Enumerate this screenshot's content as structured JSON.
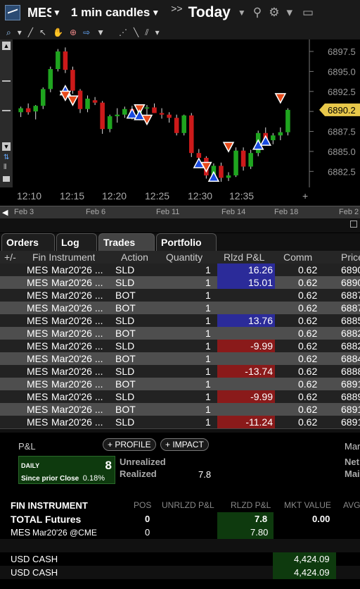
{
  "topbar": {
    "symbol": "MES",
    "interval": "1 min candles",
    "range": "Today"
  },
  "chart_data": {
    "type": "candlestick",
    "x_ticks": [
      "12:10",
      "12:15",
      "12:20",
      "12:25",
      "12:30",
      "12:35"
    ],
    "y_ticks": [
      "6897.5",
      "6895.0",
      "6892.5",
      "6890.0",
      "6887.5",
      "6885.0",
      "6882.5"
    ],
    "y_range": [
      6880.5,
      6899.0
    ],
    "current_price": "6890.2",
    "candles": [
      {
        "o": 6889.9,
        "h": 6890.6,
        "l": 6889.3,
        "c": 6890.4
      },
      {
        "o": 6890.4,
        "h": 6891.0,
        "l": 6889.6,
        "c": 6889.9
      },
      {
        "o": 6890.0,
        "h": 6890.8,
        "l": 6889.0,
        "c": 6890.7
      },
      {
        "o": 6890.7,
        "h": 6893.0,
        "l": 6890.3,
        "c": 6892.8
      },
      {
        "o": 6892.8,
        "h": 6895.6,
        "l": 6892.4,
        "c": 6895.3
      },
      {
        "o": 6895.3,
        "h": 6897.8,
        "l": 6895.0,
        "c": 6897.5
      },
      {
        "o": 6897.5,
        "h": 6898.0,
        "l": 6894.8,
        "c": 6895.2
      },
      {
        "o": 6895.2,
        "h": 6895.6,
        "l": 6892.2,
        "c": 6892.6
      },
      {
        "o": 6892.6,
        "h": 6892.8,
        "l": 6889.8,
        "c": 6890.3
      },
      {
        "o": 6890.3,
        "h": 6892.0,
        "l": 6889.9,
        "c": 6891.6
      },
      {
        "o": 6891.4,
        "h": 6891.8,
        "l": 6890.8,
        "c": 6891.1
      },
      {
        "o": 6891.1,
        "h": 6891.3,
        "l": 6887.2,
        "c": 6887.8
      },
      {
        "o": 6887.8,
        "h": 6889.6,
        "l": 6887.4,
        "c": 6889.4
      },
      {
        "o": 6889.4,
        "h": 6890.4,
        "l": 6888.6,
        "c": 6889.6
      },
      {
        "o": 6889.6,
        "h": 6890.6,
        "l": 6889.2,
        "c": 6890.3
      },
      {
        "o": 6890.3,
        "h": 6890.7,
        "l": 6889.0,
        "c": 6889.3
      },
      {
        "o": 6889.3,
        "h": 6890.5,
        "l": 6888.9,
        "c": 6890.4
      },
      {
        "o": 6890.4,
        "h": 6890.8,
        "l": 6889.6,
        "c": 6890.5
      },
      {
        "o": 6890.5,
        "h": 6891.0,
        "l": 6889.8,
        "c": 6889.8
      },
      {
        "o": 6889.8,
        "h": 6890.4,
        "l": 6889.1,
        "c": 6889.6
      },
      {
        "o": 6889.6,
        "h": 6889.9,
        "l": 6888.6,
        "c": 6889.2
      },
      {
        "o": 6889.2,
        "h": 6889.6,
        "l": 6887.0,
        "c": 6887.3
      },
      {
        "o": 6887.3,
        "h": 6889.6,
        "l": 6887.0,
        "c": 6889.5
      },
      {
        "o": 6889.5,
        "h": 6889.8,
        "l": 6884.3,
        "c": 6884.8
      },
      {
        "o": 6884.8,
        "h": 6885.3,
        "l": 6884.0,
        "c": 6884.2
      },
      {
        "o": 6884.2,
        "h": 6884.4,
        "l": 6881.6,
        "c": 6882.0
      },
      {
        "o": 6882.0,
        "h": 6883.5,
        "l": 6881.5,
        "c": 6883.2
      },
      {
        "o": 6883.2,
        "h": 6883.6,
        "l": 6881.2,
        "c": 6881.7
      },
      {
        "o": 6881.7,
        "h": 6882.4,
        "l": 6881.3,
        "c": 6882.0
      },
      {
        "o": 6882.0,
        "h": 6885.5,
        "l": 6881.8,
        "c": 6885.1
      },
      {
        "o": 6885.1,
        "h": 6885.5,
        "l": 6882.6,
        "c": 6883.1
      },
      {
        "o": 6883.1,
        "h": 6885.2,
        "l": 6882.8,
        "c": 6884.8
      },
      {
        "o": 6884.8,
        "h": 6887.6,
        "l": 6884.4,
        "c": 6887.3
      },
      {
        "o": 6887.3,
        "h": 6888.0,
        "l": 6885.9,
        "c": 6886.4
      },
      {
        "o": 6886.4,
        "h": 6887.3,
        "l": 6885.9,
        "c": 6887.0
      },
      {
        "o": 6887.0,
        "h": 6888.0,
        "l": 6886.4,
        "c": 6887.4
      },
      {
        "o": 6887.4,
        "h": 6890.4,
        "l": 6887.0,
        "c": 6890.2
      }
    ],
    "trade_markers": [
      {
        "i": 6,
        "side": "BOT",
        "price": 6892.6
      },
      {
        "i": 6,
        "side": "SLD",
        "price": 6892.0
      },
      {
        "i": 7,
        "side": "SLD",
        "price": 6891.4
      },
      {
        "i": 15,
        "side": "BOT",
        "price": 6889.7
      },
      {
        "i": 16,
        "side": "SLD",
        "price": 6890.3
      },
      {
        "i": 16,
        "side": "BOT",
        "price": 6889.5
      },
      {
        "i": 17,
        "side": "SLD",
        "price": 6889.0
      },
      {
        "i": 24,
        "side": "BOT",
        "price": 6883.5
      },
      {
        "i": 25,
        "side": "SLD",
        "price": 6883.1
      },
      {
        "i": 26,
        "side": "BOT",
        "price": 6881.8
      },
      {
        "i": 28,
        "side": "SLD",
        "price": 6885.6
      },
      {
        "i": 32,
        "side": "BOT",
        "price": 6885.8
      },
      {
        "i": 33,
        "side": "BOT",
        "price": 6886.3
      },
      {
        "i": 35,
        "side": "SLD",
        "price": 6891.7
      }
    ]
  },
  "navigator": {
    "dates": [
      "Feb 3",
      "Feb 6",
      "Feb 11",
      "Feb 14",
      "Feb 18",
      "Feb 2"
    ]
  },
  "tabs": [
    "Orders",
    "Log",
    "Trades",
    "Portfolio"
  ],
  "trades": {
    "columns": [
      "+/-",
      "Fin Instrument",
      "Action",
      "Quantity",
      "Rlzd P&L",
      "Comm",
      "Price"
    ],
    "rows": [
      {
        "sym": "MES",
        "exp": "Mar20'26 ...",
        "action": "SLD",
        "qty": "1",
        "pnl": "16.26",
        "pnl_sign": "pos",
        "comm": "0.62",
        "price": "6890"
      },
      {
        "sym": "MES",
        "exp": "Mar20'26 ...",
        "action": "SLD",
        "qty": "1",
        "pnl": "15.01",
        "pnl_sign": "pos",
        "comm": "0.62",
        "price": "6890"
      },
      {
        "sym": "MES",
        "exp": "Mar20'26 ...",
        "action": "BOT",
        "qty": "1",
        "pnl": "",
        "pnl_sign": "",
        "comm": "0.62",
        "price": "6887"
      },
      {
        "sym": "MES",
        "exp": "Mar20'26 ...",
        "action": "BOT",
        "qty": "1",
        "pnl": "",
        "pnl_sign": "",
        "comm": "0.62",
        "price": "6887"
      },
      {
        "sym": "MES",
        "exp": "Mar20'26 ...",
        "action": "SLD",
        "qty": "1",
        "pnl": "13.76",
        "pnl_sign": "pos",
        "comm": "0.62",
        "price": "6885"
      },
      {
        "sym": "MES",
        "exp": "Mar20'26 ...",
        "action": "BOT",
        "qty": "1",
        "pnl": "",
        "pnl_sign": "",
        "comm": "0.62",
        "price": "6882"
      },
      {
        "sym": "MES",
        "exp": "Mar20'26 ...",
        "action": "SLD",
        "qty": "1",
        "pnl": "-9.99",
        "pnl_sign": "neg",
        "comm": "0.62",
        "price": "6882"
      },
      {
        "sym": "MES",
        "exp": "Mar20'26 ...",
        "action": "BOT",
        "qty": "1",
        "pnl": "",
        "pnl_sign": "",
        "comm": "0.62",
        "price": "6884"
      },
      {
        "sym": "MES",
        "exp": "Mar20'26 ...",
        "action": "SLD",
        "qty": "1",
        "pnl": "-13.74",
        "pnl_sign": "neg",
        "comm": "0.62",
        "price": "6888"
      },
      {
        "sym": "MES",
        "exp": "Mar20'26 ...",
        "action": "BOT",
        "qty": "1",
        "pnl": "",
        "pnl_sign": "",
        "comm": "0.62",
        "price": "6891"
      },
      {
        "sym": "MES",
        "exp": "Mar20'26 ...",
        "action": "SLD",
        "qty": "1",
        "pnl": "-9.99",
        "pnl_sign": "neg",
        "comm": "0.62",
        "price": "6889"
      },
      {
        "sym": "MES",
        "exp": "Mar20'26 ...",
        "action": "BOT",
        "qty": "1",
        "pnl": "",
        "pnl_sign": "",
        "comm": "0.62",
        "price": "6891"
      },
      {
        "sym": "MES",
        "exp": "Mar20'26 ...",
        "action": "SLD",
        "qty": "1",
        "pnl": "-11.24",
        "pnl_sign": "neg",
        "comm": "0.62",
        "price": "6891"
      }
    ]
  },
  "portfolio": {
    "pnl_title": "P&L",
    "profile_btn": "+ PROFILE",
    "impact_btn": "+ IMPACT",
    "right_cut": "Mar",
    "right_net": "Net",
    "right_mai": "Mai",
    "daily_label": "DAILY",
    "daily_value": "8",
    "since_label": "Since prior Close",
    "since_value": "0.18%",
    "unrealized_label": "Unrealized",
    "realized_label": "Realized",
    "realized_value": "7.8",
    "columns": [
      "FIN INSTRUMENT",
      "POS",
      "UNRLZD P&L",
      "RLZD P&L",
      "MKT VALUE",
      "AVG"
    ],
    "total_label": "TOTAL Futures",
    "total_pos": "0",
    "total_rlzd": "7.8",
    "total_mkt": "0.00",
    "mes_label": "MES",
    "mes_detail": "Mar20'26 @CME",
    "mes_pos": "0",
    "mes_rlzd": "7.80",
    "cash1_label": "USD CASH",
    "cash1_value": "4,424.09",
    "cash2_label": "USD CASH",
    "cash2_value": "4,424.09"
  }
}
